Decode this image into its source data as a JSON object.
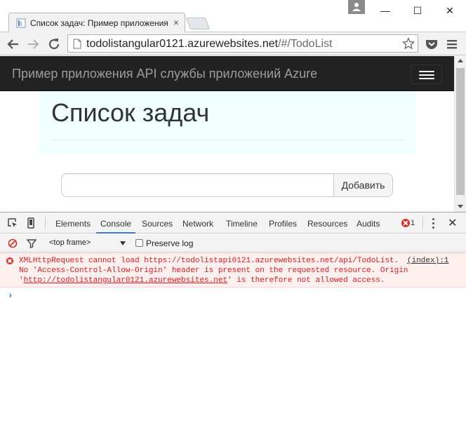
{
  "browser": {
    "tab_title": "Список задач: Пример приложения",
    "tab_close": "×",
    "window_minimize": "—",
    "window_maximize": "☐",
    "window_close": "✕"
  },
  "toolbar": {
    "url_host": "todolistangular0121.azurewebsites.net",
    "url_path": "/#/TodoList"
  },
  "page": {
    "brand": "Пример приложения API службы приложений Azure",
    "heading": "Список задач",
    "task_input_value": "",
    "add_button": "Добавить"
  },
  "devtools": {
    "tabs": [
      "Elements",
      "Console",
      "Sources",
      "Network",
      "Timeline",
      "Profiles",
      "Resources",
      "Audits"
    ],
    "active_tab": "Console",
    "error_count": "1",
    "close": "✕",
    "frame_select": "<top frame>",
    "preserve_log": "Preserve log",
    "console_error": {
      "line1": "XMLHttpRequest cannot load https://todolistapi0121.azurewebsites.net/api/TodoList.",
      "line2": "No 'Access-Control-Allow-Origin' header is present on the requested resource. Origin",
      "line3_prefix": "'",
      "line3_link": "http://todolistangular0121.azurewebsites.net",
      "line3_suffix": "' is therefore not allowed access.",
      "source": "(index):1"
    },
    "prompt": "›"
  },
  "colors": {
    "navbar_bg": "#222222",
    "jumbotron_bg": "#f0ffff",
    "error_text": "#e01b1b",
    "error_row_bg": "#fff0f0",
    "active_tab_underline": "#3879d9"
  },
  "icons": [
    "favicon-icon",
    "user-profile-icon",
    "back-icon",
    "forward-icon",
    "reload-icon",
    "page-icon",
    "star-icon",
    "pocket-icon",
    "menu-icon",
    "inspect-icon",
    "device-icon",
    "error-icon",
    "more-icon",
    "clear-console-icon",
    "filter-icon"
  ]
}
